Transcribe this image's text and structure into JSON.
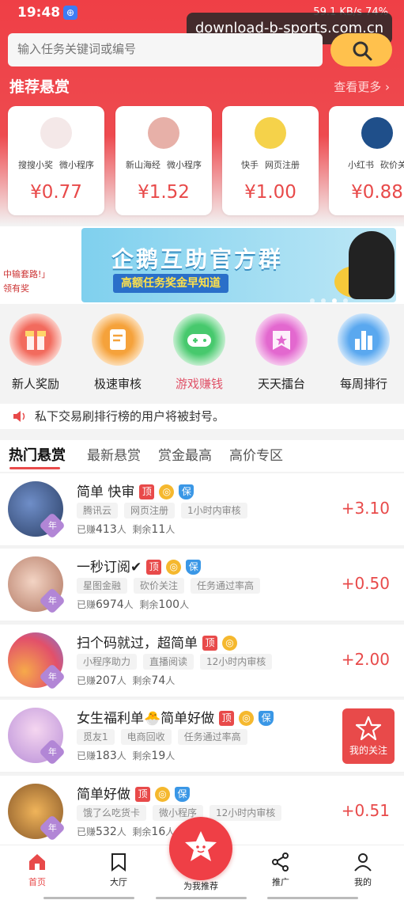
{
  "status": {
    "time": "19:48",
    "right": "59.1 KB/s  74%"
  },
  "watermark": "download-b-sports.com.cn",
  "search": {
    "placeholder": "输入任务关键词或编号"
  },
  "recommend": {
    "title": "推荐悬赏",
    "more": "查看更多 ›",
    "cards": [
      {
        "tag1": "搜搜小奖",
        "tag2": "微小程序",
        "price": "¥0.77",
        "color": "#f4e8e8"
      },
      {
        "tag1": "新山海经",
        "tag2": "微小程序",
        "price": "¥1.52",
        "color": "#e7b0a8"
      },
      {
        "tag1": "快手",
        "tag2": "网页注册",
        "price": "¥1.00",
        "color": "#f5d24a"
      },
      {
        "tag1": "小红书",
        "tag2": "砍价关",
        "price": "¥0.88",
        "color": "#1f4f8a"
      }
    ]
  },
  "banner": {
    "left_text": "中输套路!」",
    "left_sub": "领有奖",
    "title": "企鹅互助官方群",
    "subtitle": "高额任务奖金早知道"
  },
  "quick": [
    {
      "label": "新人奖励",
      "icon": "gift-icon",
      "color": "#f26b5e"
    },
    {
      "label": "极速审核",
      "icon": "review-icon",
      "color": "#f5a23b"
    },
    {
      "label": "游戏赚钱",
      "icon": "gamepad-icon",
      "color": "#47c96d"
    },
    {
      "label": "天天擂台",
      "icon": "flag-icon",
      "color": "#e368cf"
    },
    {
      "label": "每周排行",
      "icon": "ranking-icon",
      "color": "#5aa8ef"
    }
  ],
  "notice": "私下交易刷排行榜的用户将被封号。",
  "tabs": [
    "热门悬赏",
    "最新悬赏",
    "赏金最高",
    "高价专区"
  ],
  "tasks": [
    {
      "title": "简单 快审",
      "tags": [
        "腾讯云",
        "网页注册",
        "1小时内审核"
      ],
      "earned_label": "已赚",
      "earned": "413",
      "unit": "人",
      "remain_label": "剩余",
      "remain": "11",
      "price": "+3.10",
      "bao": true,
      "img": "#2a3e64"
    },
    {
      "title": "一秒订阅✔",
      "tags": [
        "星图金融",
        "砍价关注",
        "任务通过率高"
      ],
      "earned_label": "已赚",
      "earned": "6974",
      "unit": "人",
      "remain_label": "剩余",
      "remain": "100",
      "price": "+0.50",
      "bao": true,
      "img": "#d9a08a"
    },
    {
      "title": "扫个码就过，超简单",
      "tags": [
        "小程序助力",
        "直播阅读",
        "12小时内审核"
      ],
      "earned_label": "已赚",
      "earned": "207",
      "unit": "人",
      "remain_label": "剩余",
      "remain": "74",
      "price": "+2.00",
      "bao": false,
      "img": "#e86a5a"
    },
    {
      "title": "女生福利单🐣简单好做",
      "tags": [
        "觅友1",
        "电商回收",
        "任务通过率高"
      ],
      "earned_label": "已赚",
      "earned": "183",
      "unit": "人",
      "remain_label": "剩余",
      "remain": "19",
      "price": "",
      "bao": true,
      "img": "#c9a3e0"
    },
    {
      "title": "简单好做",
      "tags": [
        "饿了么吃货卡",
        "微小程序",
        "12小时内审核"
      ],
      "earned_label": "已赚",
      "earned": "532",
      "unit": "人",
      "remain_label": "剩余",
      "remain": "16",
      "price": "+0.51",
      "bao": true,
      "img": "#d99a3a"
    }
  ],
  "badges": {
    "ding": "顶",
    "bao": "保",
    "year": "年"
  },
  "fav_button": "我的关注",
  "nav": {
    "home": "首页",
    "hall": "大厅",
    "center": "为我推荐",
    "promote": "推广",
    "mine": "我的"
  }
}
